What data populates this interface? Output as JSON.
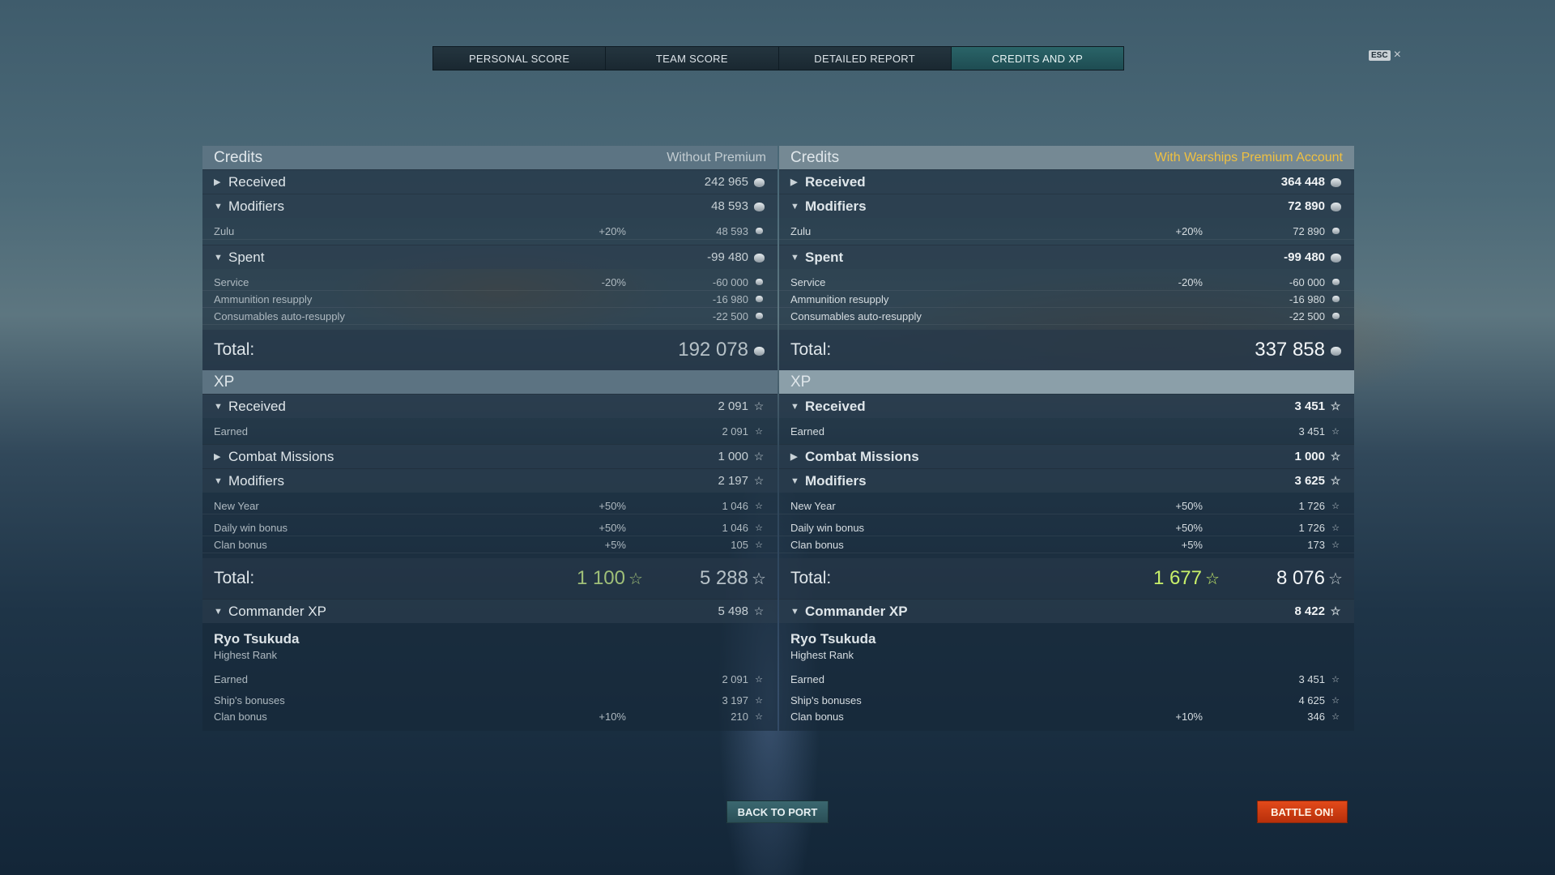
{
  "tabs": [
    "PERSONAL SCORE",
    "TEAM SCORE",
    "DETAILED REPORT",
    "CREDITS AND XP"
  ],
  "esc": {
    "key": "ESC",
    "close": "×"
  },
  "left": {
    "credits_title": "Credits",
    "credits_note": "Without Premium",
    "received": {
      "label": "Received",
      "value": "242 965"
    },
    "modifiers": {
      "label": "Modifiers",
      "value": "48 593"
    },
    "mod_rows": [
      {
        "label": "Zulu",
        "mod": "+20%",
        "value": "48 593"
      }
    ],
    "spent": {
      "label": "Spent",
      "value": "-99 480"
    },
    "spent_rows": [
      {
        "label": "Service",
        "mod": "-20%",
        "value": "-60 000"
      },
      {
        "label": "Ammunition resupply",
        "mod": "",
        "value": "-16 980"
      },
      {
        "label": "Consumables auto-resupply",
        "mod": "",
        "value": "-22 500"
      }
    ],
    "credits_total": {
      "label": "Total:",
      "value": "192 078"
    },
    "xp_title": "XP",
    "xp_received": {
      "label": "Received",
      "value": "2 091"
    },
    "xp_received_rows": [
      {
        "label": "Earned",
        "value": "2 091"
      }
    ],
    "combat_missions": {
      "label": "Combat Missions",
      "value": "1 000"
    },
    "xp_modifiers": {
      "label": "Modifiers",
      "value": "2 197"
    },
    "xp_mod_rows": [
      {
        "label": "New Year",
        "mod": "+50%",
        "value": "1 046"
      },
      {
        "label": "Daily win bonus",
        "mod": "+50%",
        "value": "1 046"
      },
      {
        "label": "Clan bonus",
        "mod": "+5%",
        "value": "105"
      }
    ],
    "xp_total": {
      "label": "Total:",
      "extra": "1 100",
      "value": "5 288"
    },
    "commander_xp": {
      "label": "Commander XP",
      "value": "5 498"
    },
    "commander": {
      "name": "Ryo Tsukuda",
      "rank": "Highest Rank"
    },
    "cmdr_rows": [
      {
        "label": "Earned",
        "mod": "",
        "value": "2 091"
      },
      {
        "label": "Ship's bonuses",
        "mod": "",
        "value": "3 197"
      },
      {
        "label": "Clan bonus",
        "mod": "+10%",
        "value": "210"
      }
    ]
  },
  "right": {
    "credits_title": "Credits",
    "credits_note": "With Warships Premium Account",
    "received": {
      "label": "Received",
      "value": "364 448"
    },
    "modifiers": {
      "label": "Modifiers",
      "value": "72 890"
    },
    "mod_rows": [
      {
        "label": "Zulu",
        "mod": "+20%",
        "value": "72 890"
      }
    ],
    "spent": {
      "label": "Spent",
      "value": "-99 480"
    },
    "spent_rows": [
      {
        "label": "Service",
        "mod": "-20%",
        "value": "-60 000"
      },
      {
        "label": "Ammunition resupply",
        "mod": "",
        "value": "-16 980"
      },
      {
        "label": "Consumables auto-resupply",
        "mod": "",
        "value": "-22 500"
      }
    ],
    "credits_total": {
      "label": "Total:",
      "value": "337 858"
    },
    "xp_title": "XP",
    "xp_received": {
      "label": "Received",
      "value": "3 451"
    },
    "xp_received_rows": [
      {
        "label": "Earned",
        "value": "3 451"
      }
    ],
    "combat_missions": {
      "label": "Combat Missions",
      "value": "1 000"
    },
    "xp_modifiers": {
      "label": "Modifiers",
      "value": "3 625"
    },
    "xp_mod_rows": [
      {
        "label": "New Year",
        "mod": "+50%",
        "value": "1 726"
      },
      {
        "label": "Daily win bonus",
        "mod": "+50%",
        "value": "1 726"
      },
      {
        "label": "Clan bonus",
        "mod": "+5%",
        "value": "173"
      }
    ],
    "xp_total": {
      "label": "Total:",
      "extra": "1 677",
      "value": "8 076"
    },
    "commander_xp": {
      "label": "Commander XP",
      "value": "8 422"
    },
    "commander": {
      "name": "Ryo Tsukuda",
      "rank": "Highest Rank"
    },
    "cmdr_rows": [
      {
        "label": "Earned",
        "mod": "",
        "value": "3 451"
      },
      {
        "label": "Ship's bonuses",
        "mod": "",
        "value": "4 625"
      },
      {
        "label": "Clan bonus",
        "mod": "+10%",
        "value": "346"
      }
    ]
  },
  "buttons": {
    "back": "BACK TO PORT",
    "battle": "BATTLE ON!"
  },
  "colors": {
    "accent_tab": "#2a6468",
    "premium_note": "#f0c040",
    "battle": "#d23c12",
    "xp_bonus": "#c8f06a"
  },
  "icons": {
    "credits": "credit-coin-icon",
    "xp": "star-icon",
    "expand": "triangle-right-icon",
    "collapse": "triangle-down-icon"
  }
}
